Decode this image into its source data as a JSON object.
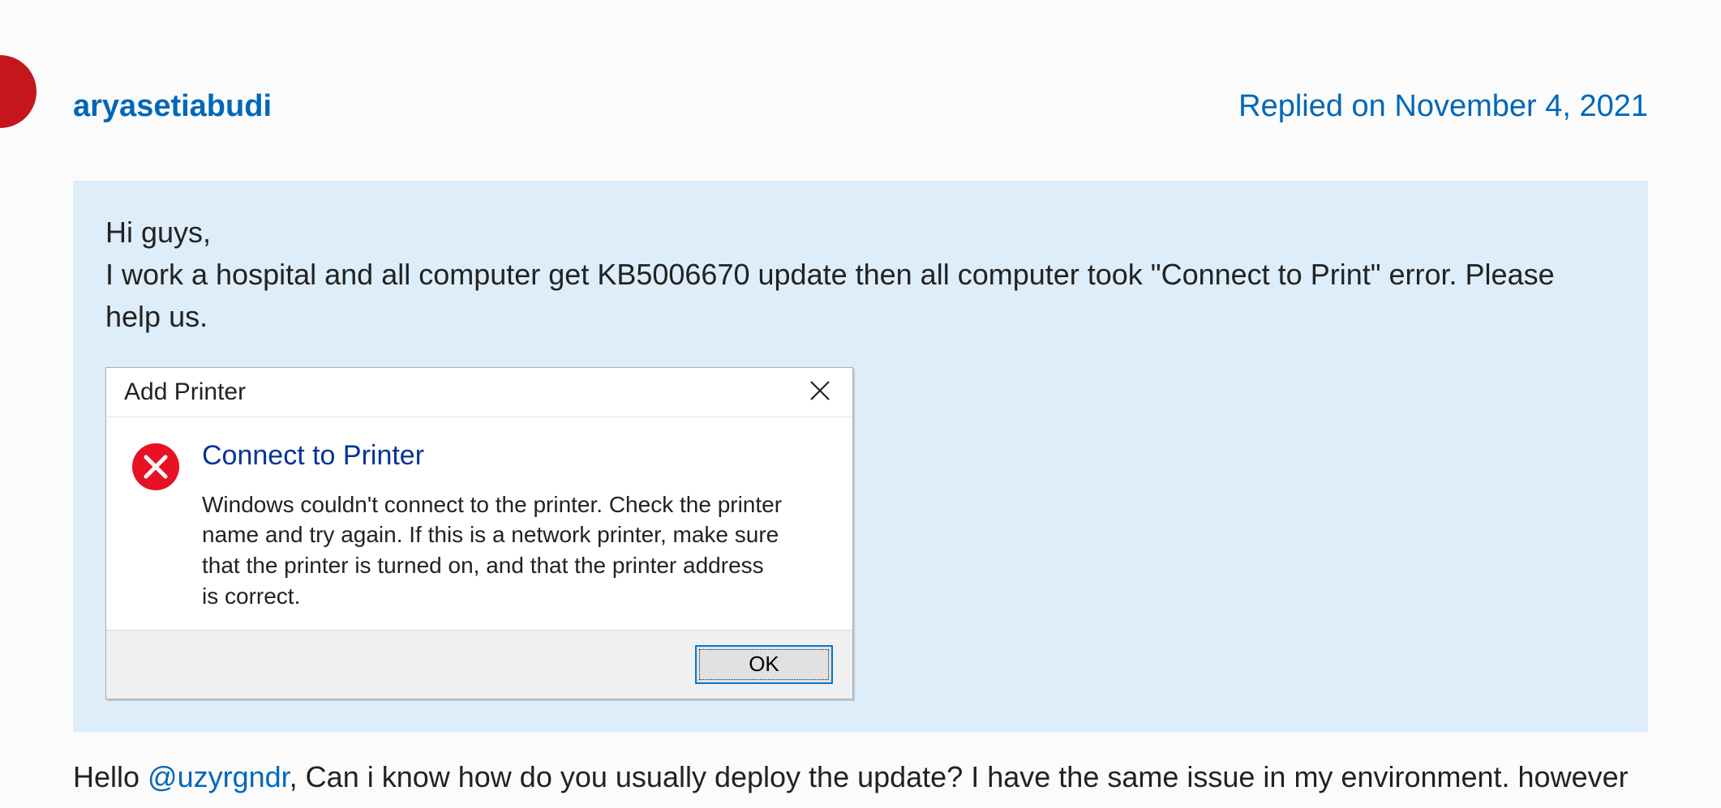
{
  "post": {
    "username": "aryasetiabudi",
    "reply_date": "Replied on November 4, 2021"
  },
  "quote": {
    "line1": "Hi guys,",
    "line2": "I work a hospital and all computer get KB5006670 update then all computer took \"Connect to Print\" error. Please help us."
  },
  "dialog": {
    "title": "Add Printer",
    "heading": "Connect to Printer",
    "message": "Windows couldn't connect to the printer. Check the printer name and try again. If this is a network printer, make sure that the printer is turned on, and that the printer address is correct.",
    "ok_label": "OK"
  },
  "reply": {
    "prefix": "Hello ",
    "mention": "@uzyrgndr",
    "rest": ", Can i know how do you usually deploy the update? I have the same issue in my environment. however"
  }
}
